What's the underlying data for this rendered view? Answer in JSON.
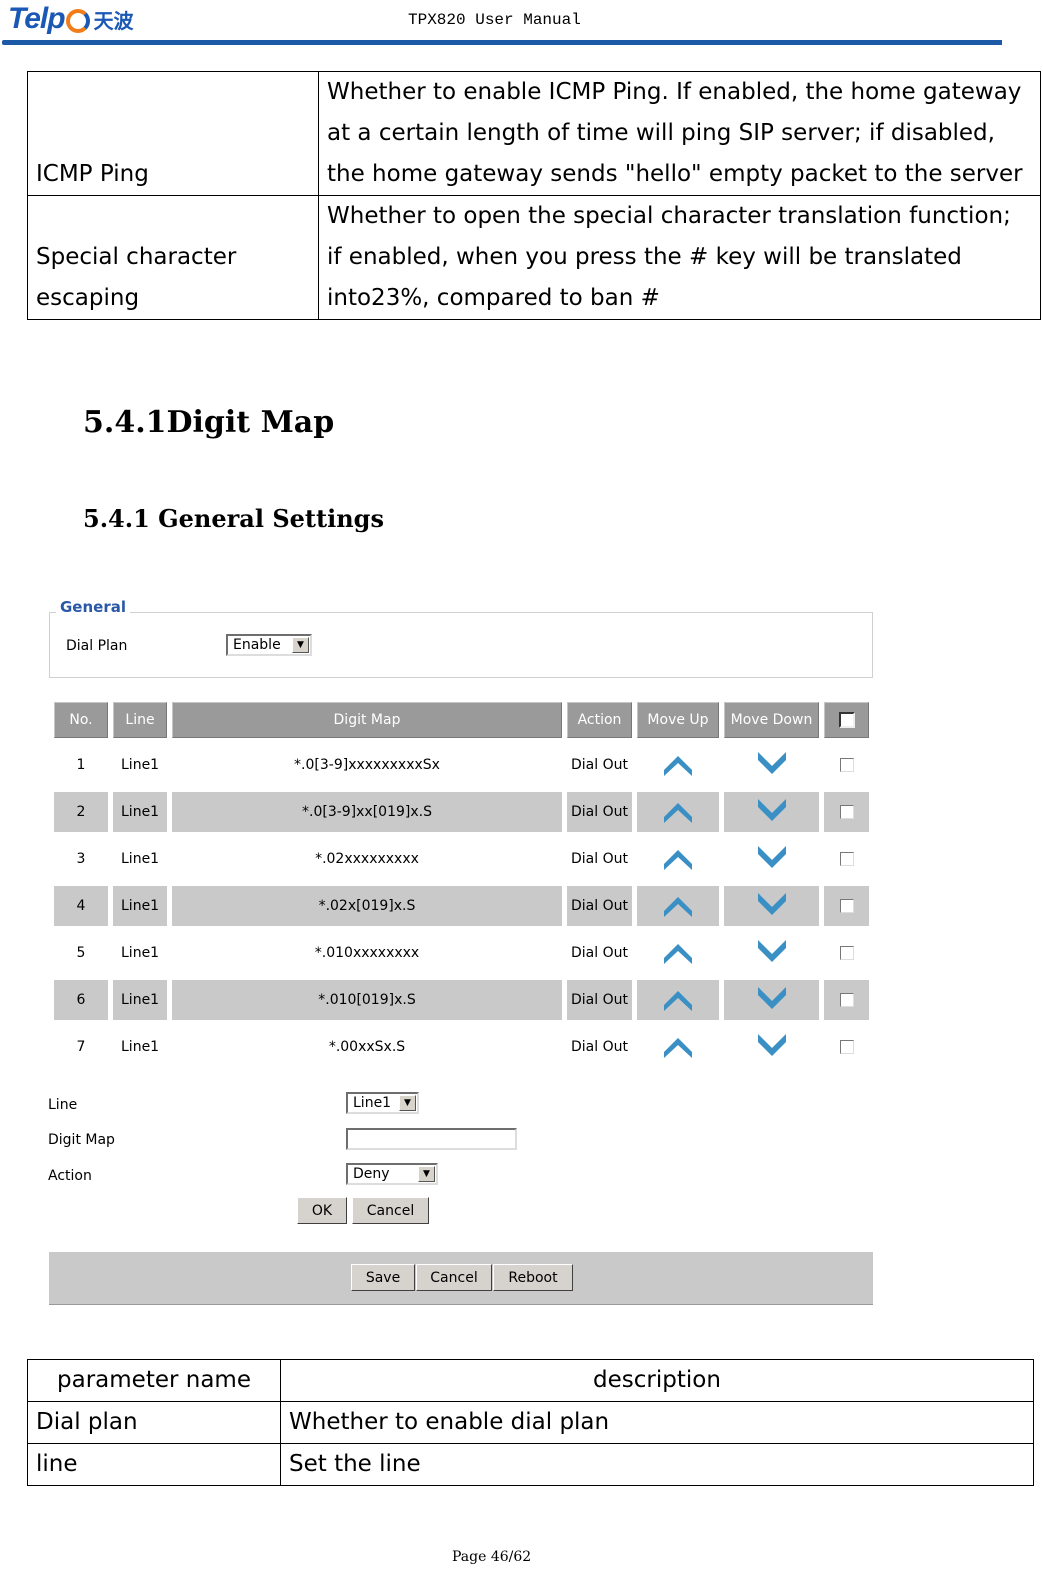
{
  "header": {
    "logo_latin": "Telp",
    "logo_cn": "天波",
    "title": "TPX820 User Manual"
  },
  "top_table": {
    "rows": [
      {
        "name": "ICMP Ping",
        "description": "Whether to enable ICMP Ping. If enabled, the home gateway at a certain length of time will ping SIP server; if disabled, the home gateway sends \"hello\" empty packet to the server"
      },
      {
        "name": "Special character escaping",
        "description": "Whether to open the special character translation function; if enabled, when you press the # key will be translated into23%, compared to ban #"
      }
    ]
  },
  "headings": {
    "h1": "5.4.1Digit Map",
    "h2": "5.4.1 General Settings"
  },
  "ui": {
    "general_legend": "General",
    "dial_plan_label": "Dial Plan",
    "dial_plan_value": "Enable",
    "table_headers": [
      "No.",
      "Line",
      "Digit Map",
      "Action",
      "Move Up",
      "Move Down"
    ],
    "rows": [
      {
        "no": "1",
        "line": "Line1",
        "map": "*.0[3-9]xxxxxxxxxSx",
        "action": "Dial Out",
        "checked": false
      },
      {
        "no": "2",
        "line": "Line1",
        "map": "*.0[3-9]xx[019]x.S",
        "action": "Dial Out",
        "checked": false
      },
      {
        "no": "3",
        "line": "Line1",
        "map": "*.02xxxxxxxxx",
        "action": "Dial Out",
        "checked": false
      },
      {
        "no": "4",
        "line": "Line1",
        "map": "*.02x[019]x.S",
        "action": "Dial Out",
        "checked": false
      },
      {
        "no": "5",
        "line": "Line1",
        "map": "*.010xxxxxxxx",
        "action": "Dial Out",
        "checked": false
      },
      {
        "no": "6",
        "line": "Line1",
        "map": "*.010[019]x.S",
        "action": "Dial Out",
        "checked": false
      },
      {
        "no": "7",
        "line": "Line1",
        "map": "*.00xxSx.S",
        "action": "Dial Out",
        "checked": false
      }
    ],
    "form": {
      "line_label": "Line",
      "line_value": "Line1",
      "digit_map_label": "Digit Map",
      "digit_map_value": "",
      "action_label": "Action",
      "action_value": "Deny",
      "ok_label": "OK",
      "cancel_label": "Cancel"
    },
    "footer": {
      "save_label": "Save",
      "cancel_label": "Cancel",
      "reboot_label": "Reboot"
    },
    "colors": {
      "arrow": "#3a8fc4",
      "legend": "#2a58a8",
      "header_cell": "#9a9a9a",
      "alt_row": "#c9c9c9"
    }
  },
  "param_table": {
    "headers": [
      "parameter name",
      "description"
    ],
    "rows": [
      {
        "name": "Dial plan",
        "description": "Whether to enable dial plan"
      },
      {
        "name": "line",
        "description": "Set the line"
      }
    ]
  },
  "footer": {
    "page": "Page 46/62"
  }
}
